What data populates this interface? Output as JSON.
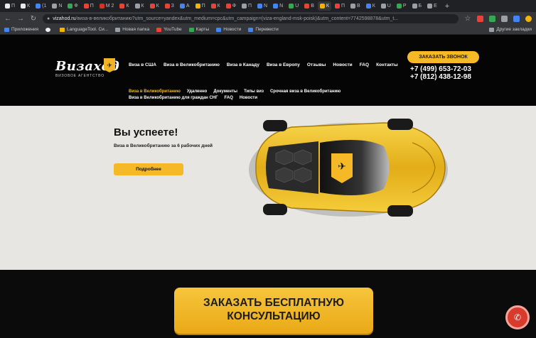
{
  "browser": {
    "tabs": [
      {
        "label": "П",
        "color": "#e8eaed",
        "active": false
      },
      {
        "label": "К",
        "color": "#e8eaed",
        "active": false
      },
      {
        "label": "(1",
        "color": "#4285f4",
        "active": false
      },
      {
        "label": "N",
        "color": "#9aa0a6",
        "active": false
      },
      {
        "label": "Ф",
        "color": "#34a853",
        "active": false
      },
      {
        "label": "П",
        "color": "#ea4335",
        "active": false
      },
      {
        "label": "М 2",
        "color": "#d93025",
        "active": false
      },
      {
        "label": "К",
        "color": "#ea4335",
        "active": false
      },
      {
        "label": "К",
        "color": "#9aa0a6",
        "active": false
      },
      {
        "label": "К",
        "color": "#ea4335",
        "active": false
      },
      {
        "label": "З",
        "color": "#ea4335",
        "active": false
      },
      {
        "label": "А",
        "color": "#4285f4",
        "active": false
      },
      {
        "label": "П",
        "color": "#f4b400",
        "active": false
      },
      {
        "label": "К",
        "color": "#ea4335",
        "active": false
      },
      {
        "label": "Ф",
        "color": "#ea4335",
        "active": false
      },
      {
        "label": "П",
        "color": "#9aa0a6",
        "active": false
      },
      {
        "label": "N",
        "color": "#4285f4",
        "active": false
      },
      {
        "label": "N",
        "color": "#4285f4",
        "active": false
      },
      {
        "label": "U",
        "color": "#34a853",
        "active": false
      },
      {
        "label": "В",
        "color": "#ea4335",
        "active": false
      },
      {
        "label": "К",
        "color": "#f4b400",
        "active": true
      },
      {
        "label": "П",
        "color": "#ea4335",
        "active": false
      },
      {
        "label": "В",
        "color": "#9aa0a6",
        "active": false
      },
      {
        "label": "К",
        "color": "#4285f4",
        "active": false
      },
      {
        "label": "U",
        "color": "#9aa0a6",
        "active": false
      },
      {
        "label": "Р",
        "color": "#34a853",
        "active": false
      },
      {
        "label": "Б",
        "color": "#9aa0a6",
        "active": false
      },
      {
        "label": "Е",
        "color": "#9aa0a6",
        "active": false
      }
    ],
    "new_tab": "+",
    "url_host": "vizahod.ru",
    "url_path": "/виза-в-великобританию?utm_source=yandex&utm_medium=cpc&utm_campaign=(viza-england-msk-poisk)&utm_content=7742598878&utm_t...",
    "bookmarks": [
      {
        "label": "Приложения"
      },
      {
        "label": ""
      },
      {
        "label": "LanguageTool. Си..."
      },
      {
        "label": "Новая папка"
      },
      {
        "label": "YouTube"
      },
      {
        "label": "Карты"
      },
      {
        "label": "Новости"
      },
      {
        "label": "Перевести"
      }
    ],
    "other_bookmarks": "Другие закладки"
  },
  "header": {
    "logo_text": "Визаход",
    "logo_sub": "ВИЗОВОЕ АГЕНТСТВО",
    "nav": [
      "Виза в США",
      "Виза в Великобританию",
      "Виза в Канаду",
      "Виза в Европу",
      "Отзывы",
      "Новости",
      "FAQ",
      "Контакты"
    ],
    "call_button": "ЗАКАЗАТЬ ЗВОНОК",
    "phone1": "+7 (499) 653-72-03",
    "phone2": "+7 (812) 438-12-98",
    "subnav_row1": [
      "Виза в Великобританию",
      "Удаленно",
      "Документы",
      "Типы виз",
      "Срочная виза в Великобританию"
    ],
    "subnav_row2": [
      "Виза в Великобританию для граждан СНГ",
      "FAQ",
      "Новости"
    ]
  },
  "hero": {
    "title": "Вы успеете!",
    "subtitle": "Виза в Великобританию за 6 рабочих дней",
    "button": "Подробнее"
  },
  "footer_cta": {
    "line1": "ЗАКАЗАТЬ БЕСПЛАТНУЮ",
    "line2": "КОНСУЛЬТАЦИЮ"
  },
  "colors": {
    "accent": "#f5b826",
    "header_bg": "#050505",
    "hero_bg": "#e7e6e3",
    "fab": "#d83a2b"
  }
}
